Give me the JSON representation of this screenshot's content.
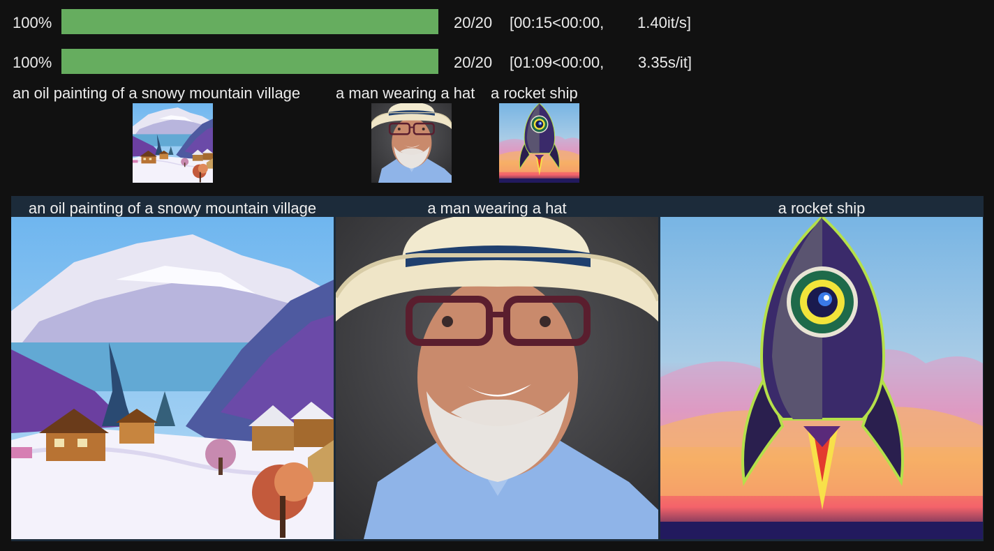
{
  "progress": [
    {
      "percent_label": "100%",
      "fraction": 1.0,
      "count": "20/20",
      "time": "[00:15<00:00,",
      "rate": "1.40it/s]"
    },
    {
      "percent_label": "100%",
      "fraction": 1.0,
      "count": "20/20",
      "time": "[01:09<00:00,",
      "rate": "3.35s/it]"
    }
  ],
  "captions": [
    "an oil painting of a snowy mountain village",
    "a man wearing a hat",
    "a rocket ship"
  ],
  "grid": {
    "labels": [
      "an oil painting of a snowy mountain village",
      "a man wearing a hat",
      "a rocket ship"
    ]
  },
  "colors": {
    "progress_fill": "#66ad5f",
    "background": "#111111",
    "grid_header": "#1c2b3a"
  }
}
